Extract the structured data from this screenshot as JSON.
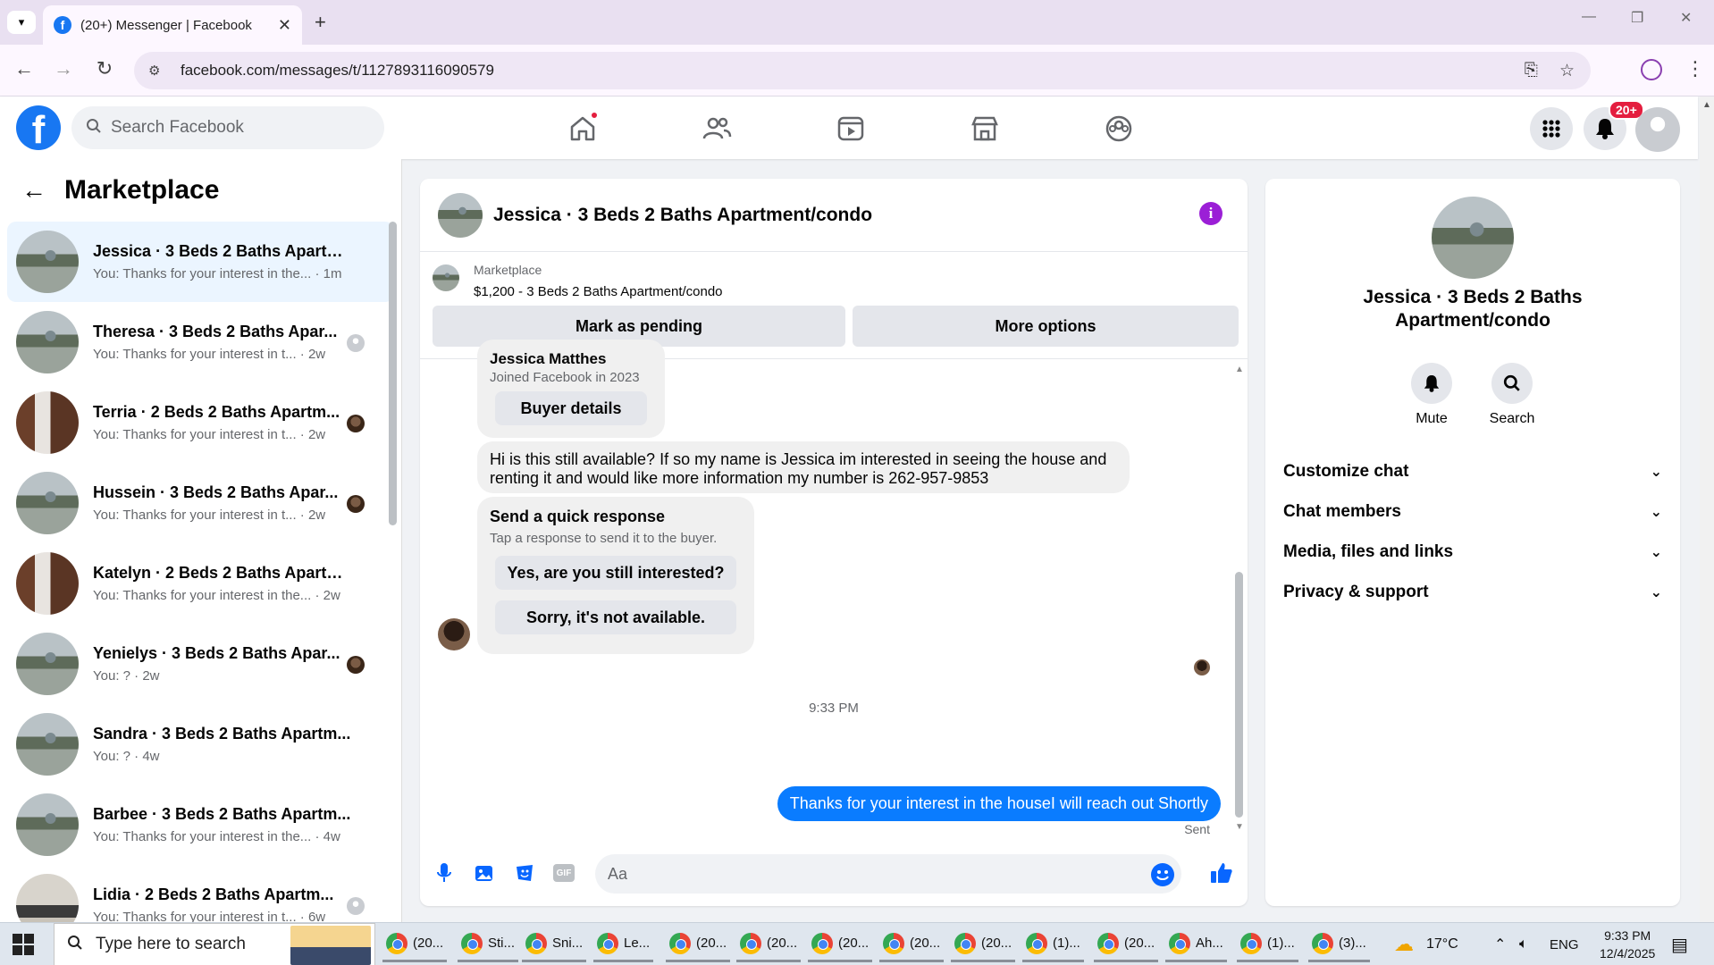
{
  "browser": {
    "tab_title": "(20+) Messenger | Facebook",
    "url": "facebook.com/messages/t/1127893116090579"
  },
  "fb": {
    "search_placeholder": "Search Facebook",
    "notif_badge": "20+",
    "brand_color": "#1877f2"
  },
  "sidebar": {
    "title": "Marketplace",
    "conversations": [
      {
        "name": "Jessica · 3 Beds 2 Baths Apartme...",
        "preview": "You: Thanks for your interest in the... · 1m",
        "thumb": "house",
        "mini": ""
      },
      {
        "name": "Theresa · 3 Beds 2 Baths Apar...",
        "preview": "You: Thanks for your interest in t... · 2w",
        "thumb": "house",
        "mini": "grey"
      },
      {
        "name": "Terria · 2 Beds 2 Baths Apartm...",
        "preview": "You: Thanks for your interest in t... · 2w",
        "thumb": "kitchen",
        "mini": "face"
      },
      {
        "name": "Hussein · 3 Beds 2 Baths Apar...",
        "preview": "You: Thanks for your interest in t... · 2w",
        "thumb": "house",
        "mini": "face"
      },
      {
        "name": "Katelyn · 2 Beds 2 Baths Apartm...",
        "preview": "You: Thanks for your interest in the... · 2w",
        "thumb": "kitchen",
        "mini": ""
      },
      {
        "name": "Yenielys · 3 Beds 2 Baths Apar...",
        "preview": "You: ? · 2w",
        "thumb": "house",
        "mini": "face"
      },
      {
        "name": "Sandra · 3 Beds 2 Baths Apartm...",
        "preview": "You: ? · 4w",
        "thumb": "house",
        "mini": ""
      },
      {
        "name": "Barbee · 3 Beds 2 Baths Apartm...",
        "preview": "You: Thanks for your interest in the... · 4w",
        "thumb": "house",
        "mini": ""
      },
      {
        "name": "Lidia · 2 Beds 2 Baths Apartm...",
        "preview": "You: Thanks for your interest in t... · 6w",
        "thumb": "interior",
        "mini": "grey"
      }
    ]
  },
  "chat": {
    "header_title": "Jessica · 3 Beds 2 Baths Apartment/condo",
    "marketplace_label": "Marketplace",
    "listing": "$1,200 - 3 Beds 2 Baths Apartment/condo",
    "mark_pending": "Mark as pending",
    "more_options": "More options",
    "buyer_name": "Jessica Matthes",
    "joined": "Joined Facebook in 2023",
    "buyer_details": "Buyer details",
    "incoming_message": "Hi is this still available? If so my name is Jessica im interested in seeing the house and renting it and would like more information my number is 262-957-9853",
    "quick_title": "Send a quick response",
    "quick_sub": "Tap a response to send it to the buyer.",
    "quick_1": "Yes, are you still interested?",
    "quick_2": "Sorry, it's not available.",
    "timestamp": "9:33 PM",
    "sent_message": "Thanks for your interest in the houseI will reach out Shortly",
    "sent_status": "Sent",
    "composer_placeholder": "Aa",
    "accent": "#0a7cff"
  },
  "info": {
    "name": "Jessica · 3 Beds 2 Baths Apartment/condo",
    "mute": "Mute",
    "search": "Search",
    "sections": [
      "Customize chat",
      "Chat members",
      "Media, files and links",
      "Privacy & support"
    ]
  },
  "taskbar": {
    "search_placeholder": "Type here to search",
    "items": [
      "(20...",
      "Sti...",
      "Sni...",
      "Le...",
      "(20...",
      "(20...",
      "(20...",
      "(20...",
      "(20...",
      "(1)...",
      "(20...",
      "Ah...",
      "(1)...",
      "(3)..."
    ],
    "weather": "17°C",
    "lang": "ENG",
    "time": "9:33 PM",
    "date": "12/4/2025"
  }
}
